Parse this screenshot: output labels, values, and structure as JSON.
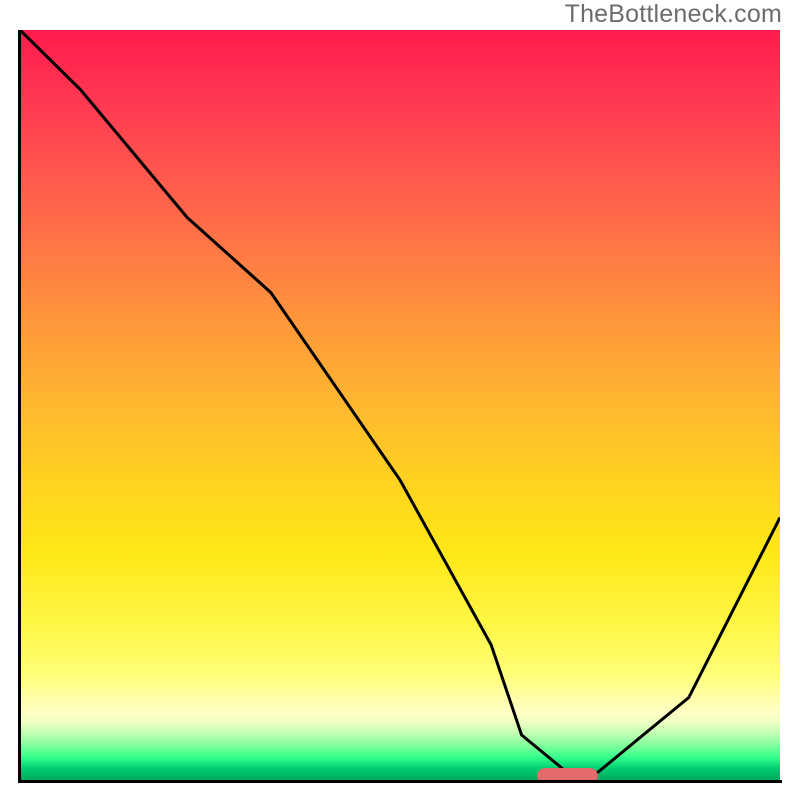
{
  "watermark": "TheBottleneck.com",
  "chart_data": {
    "type": "line",
    "title": "",
    "xlabel": "",
    "ylabel": "",
    "xlim": [
      0,
      100
    ],
    "ylim": [
      0,
      100
    ],
    "grid": false,
    "series": [
      {
        "name": "bottleneck-curve",
        "x": [
          0,
          8,
          22,
          33,
          50,
          62,
          66,
          72,
          76,
          88,
          100
        ],
        "y": [
          100,
          92,
          75,
          65,
          40,
          18,
          6,
          1,
          1,
          11,
          35
        ]
      }
    ],
    "annotations": [
      {
        "name": "optimal-marker",
        "x_start": 68,
        "x_end": 76,
        "y": 0.6,
        "color": "#e36b6b"
      }
    ],
    "background_gradient": {
      "stops": [
        {
          "pos": 0.0,
          "color": "#ff1a4d"
        },
        {
          "pos": 0.5,
          "color": "#ffb830"
        },
        {
          "pos": 0.8,
          "color": "#fff84a"
        },
        {
          "pos": 0.92,
          "color": "#e8ffc0"
        },
        {
          "pos": 1.0,
          "color": "#00a85c"
        }
      ]
    }
  }
}
